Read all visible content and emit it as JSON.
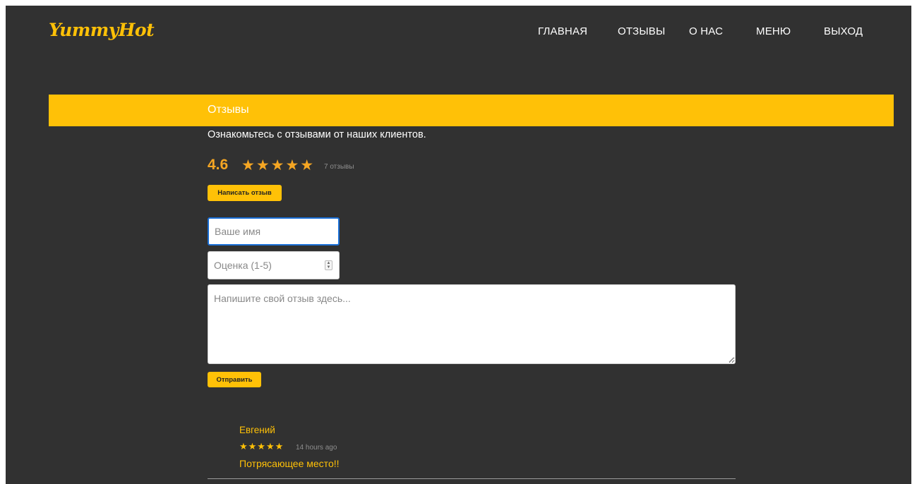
{
  "brand": {
    "logo_text": "YummyHot",
    "accent_color": "#ffc107",
    "background_color": "#313131"
  },
  "nav": {
    "items": [
      {
        "label": "ГЛАВНАЯ"
      },
      {
        "label": "ОТЗЫВЫ"
      },
      {
        "label": "О НАС"
      },
      {
        "label": "МЕНЮ"
      },
      {
        "label": "ВЫХОД"
      }
    ]
  },
  "page": {
    "title": "Отзывы",
    "subtitle": "Ознакомьтесь с отзывами от наших клиентов."
  },
  "rating_summary": {
    "average": "4.6",
    "stars": "★★★★★",
    "count_label": "7 отзывы"
  },
  "buttons": {
    "write_review": "Написать отзыв",
    "submit": "Отправить"
  },
  "form": {
    "name_placeholder": "Ваше имя",
    "score_placeholder": "Оценка (1-5)",
    "text_placeholder": "Напишите свой отзыв здесь..."
  },
  "reviews": [
    {
      "author": "Евгений",
      "stars": "★★★★★",
      "rating": 5,
      "time": "14 hours ago",
      "text": "Потрясающее место!!"
    }
  ]
}
